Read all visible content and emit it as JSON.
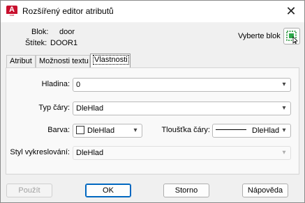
{
  "window": {
    "title": "Rozšířený editor atributů",
    "close_icon": "✕"
  },
  "info": {
    "block_label": "Blok:",
    "block_value": "door",
    "tag_label": "Štítek:",
    "tag_value": "DOOR1",
    "select_block": "Vyberte blok"
  },
  "tabs": [
    {
      "label": "Atribut",
      "active": false
    },
    {
      "label": "Možnosti textu",
      "active": false
    },
    {
      "label": "Vlastnosti",
      "active": true
    }
  ],
  "properties": {
    "layer_label": "Hladina:",
    "layer_value": "0",
    "linetype_label": "Typ čáry:",
    "linetype_value": "DleHlad",
    "color_label": "Barva:",
    "color_value": "DleHlad",
    "lineweight_label": "Tloušťka čáry:",
    "lineweight_value": "DleHlad",
    "plotstyle_label": "Styl vykreslování:",
    "plotstyle_value": "DleHlad"
  },
  "buttons": {
    "apply": "Použít",
    "ok": "OK",
    "cancel": "Storno",
    "help": "Nápověda"
  },
  "colors": {
    "accent": "#0067c0",
    "app_icon": "#c8102e"
  }
}
